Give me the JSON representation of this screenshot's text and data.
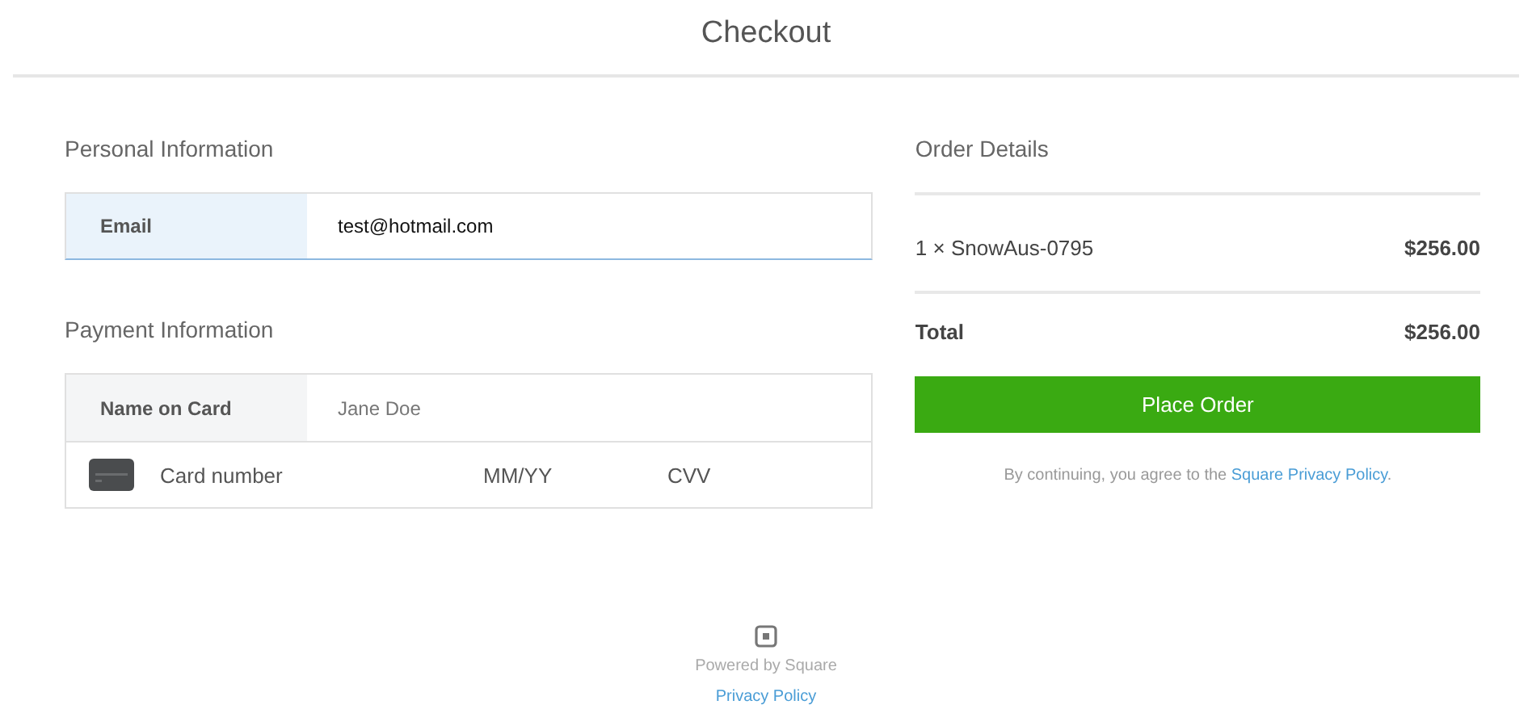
{
  "header": {
    "title": "Checkout"
  },
  "personal": {
    "heading": "Personal Information",
    "email": {
      "label": "Email",
      "value": "test@hotmail.com",
      "focused": true
    }
  },
  "payment": {
    "heading": "Payment Information",
    "name_on_card": {
      "label": "Name on Card",
      "placeholder": "Jane Doe",
      "focused": false
    },
    "card_row": [
      {
        "kind": "card_number",
        "placeholder": "Card number"
      },
      {
        "kind": "expiry",
        "placeholder": "MM/YY"
      },
      {
        "kind": "cvv",
        "placeholder": "CVV"
      }
    ]
  },
  "order": {
    "heading": "Order Details",
    "items": [
      {
        "name": "1 × SnowAus-0795",
        "price": "$256.00"
      }
    ],
    "total": {
      "label": "Total",
      "amount": "$256.00"
    },
    "button": "Place Order",
    "terms": {
      "before": "By continuing, you agree to the ",
      "link": "Square Privacy Policy",
      "after": "."
    }
  },
  "footer": {
    "powered": "Powered by Square",
    "link": "Privacy Policy"
  }
}
